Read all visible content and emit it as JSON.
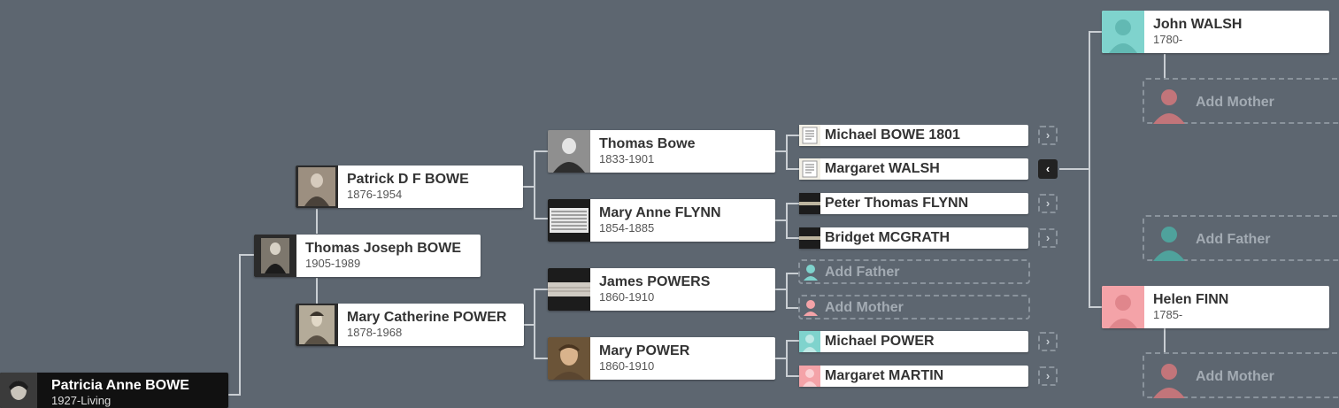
{
  "people": {
    "patricia": {
      "name": "Patricia Anne BOWE",
      "dates": "1927-Living"
    },
    "thomas_joseph": {
      "name": "Thomas Joseph BOWE",
      "dates": "1905-1989"
    },
    "patrick": {
      "name": "Patrick D F BOWE",
      "dates": "1876-1954"
    },
    "mary_catherine": {
      "name": "Mary Catherine POWER",
      "dates": "1878-1968"
    },
    "thomas_bowe": {
      "name": "Thomas Bowe",
      "dates": "1833-1901"
    },
    "mary_anne": {
      "name": "Mary Anne FLYNN",
      "dates": "1854-1885"
    },
    "james": {
      "name": "James POWERS",
      "dates": "1860-1910"
    },
    "mary_power": {
      "name": "Mary POWER",
      "dates": "1860-1910"
    },
    "john_walsh": {
      "name": "John WALSH",
      "dates": "1780-"
    },
    "helen_finn": {
      "name": "Helen FINN",
      "dates": "1785-"
    }
  },
  "small_people": {
    "michael_bowe": "Michael BOWE 1801",
    "margaret_walsh": "Margaret WALSH",
    "peter_flynn": "Peter Thomas FLYNN",
    "bridget": "Bridget MCGRATH",
    "michael_power": "Michael POWER",
    "margaret_martin": "Margaret MARTIN"
  },
  "labels": {
    "add_father": "Add Father",
    "add_mother": "Add Mother"
  },
  "icons": {
    "expand": "chevron-right-icon",
    "collapse": "chevron-left-icon"
  },
  "colors": {
    "background": "#5d6670",
    "male": "#7fd3cd",
    "female": "#f4a3a8",
    "connector": "#c9ced3"
  }
}
